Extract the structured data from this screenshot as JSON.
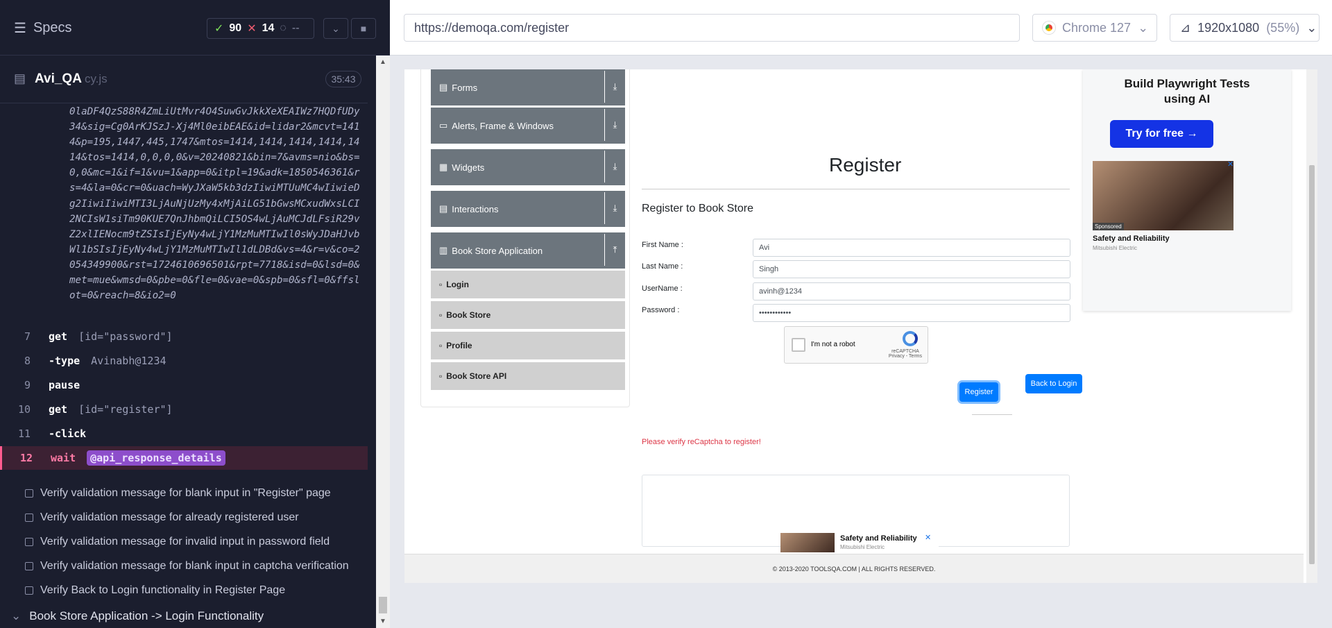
{
  "specs": {
    "title": "Specs",
    "passed": "90",
    "failed": "14",
    "pending": "--"
  },
  "file": {
    "name": "Avi_QA",
    "ext": "cy.js",
    "time": "35:43"
  },
  "code": {
    "url_text": "0laDF4QzS88R4ZmLiUtMvr4O4SuwGvJkkXeXEAIWz7HQDfUDy34&sig=Cg0ArKJSzJ-Xj4Ml0eibEAE&id=lidar2&mcvt=1414&p=195,1447,445,1747&mtos=1414,1414,1414,1414,1414&tos=1414,0,0,0,0&v=20240821&bin=7&avms=nio&bs=0,0&mc=1&if=1&vu=1&app=0&itpl=19&adk=1850546361&rs=4&la=0&cr=0&uach=WyJXaW5kb3dzIiwiMTUuMC4wIiwieDg2IiwiIiwiMTI3LjAuNjUzMy4xMjAiLG51bGwsMCxudWxsLCI2NCIsW1siTm90KUE7QnJhbmQiLCI5OS4wLjAuMCJdLFsiR29vZ2xlIENocm9tZSIsIjEyNy4wLjY1MzMuMTIwIl0sWyJDaHJvbWl1bSIsIjEyNy4wLjY1MzMuMTIwIl1dLDBd&vs=4&r=v&co=2054349900&rst=1724610696501&rpt=7718&isd=0&lsd=0&met=mue&wmsd=0&pbe=0&fle=0&vae=0&spb=0&sfl=0&ffslot=0&reach=8&io2=0",
    "commands": [
      {
        "line": "7",
        "kw": "get",
        "arg": "[id=\"password\"]"
      },
      {
        "line": "8",
        "kw": "-type",
        "arg": "Avinabh@1234"
      },
      {
        "line": "9",
        "kw": "pause",
        "arg": ""
      },
      {
        "line": "10",
        "kw": "get",
        "arg": "[id=\"register\"]"
      },
      {
        "line": "11",
        "kw": "-click",
        "arg": ""
      },
      {
        "line": "12",
        "kw": "wait",
        "arg": "@api_response_details"
      }
    ]
  },
  "tests": [
    "Verify validation message for blank input in \"Register\" page",
    "Verify validation message for already registered user",
    "Verify validation message for invalid input in password field",
    "Verify validation message for blank input in captcha verification",
    "Verify Back to Login functionality in Register Page"
  ],
  "suite": "Book Store Application -> Login Functionality",
  "browser": {
    "url": "https://demoqa.com/register",
    "name": "Chrome 127",
    "viewport": "1920x1080",
    "zoom": "(55%)"
  },
  "menu": {
    "groups": [
      "Forms",
      "Alerts, Frame & Windows",
      "Widgets",
      "Interactions",
      "Book Store Application"
    ],
    "subs": [
      "Login",
      "Book Store",
      "Profile",
      "Book Store API"
    ]
  },
  "form": {
    "title": "Register",
    "subtitle": "Register to Book Store",
    "first_label": "First Name :",
    "first_value": "Avi",
    "last_label": "Last Name :",
    "last_value": "Singh",
    "user_label": "UserName :",
    "user_value": "avinh@1234",
    "pass_label": "Password :",
    "pass_value": "••••••••••••",
    "captcha_text": "I'm not a robot",
    "captcha_brand": "reCAPTCHA",
    "captcha_links": "Privacy - Terms",
    "register_btn": "Register",
    "back_btn": "Back to Login",
    "error": "Please verify reCaptcha to register!"
  },
  "ad": {
    "title": "Build Playwright Tests using AI",
    "button": "Try for free →",
    "img_sponsored": "Sponsored",
    "caption": "Safety and Reliability",
    "company": "Mitsubishi Electric",
    "close": "✕"
  },
  "footer": "© 2013-2020 TOOLSQA.COM | ALL RIGHTS RESERVED."
}
